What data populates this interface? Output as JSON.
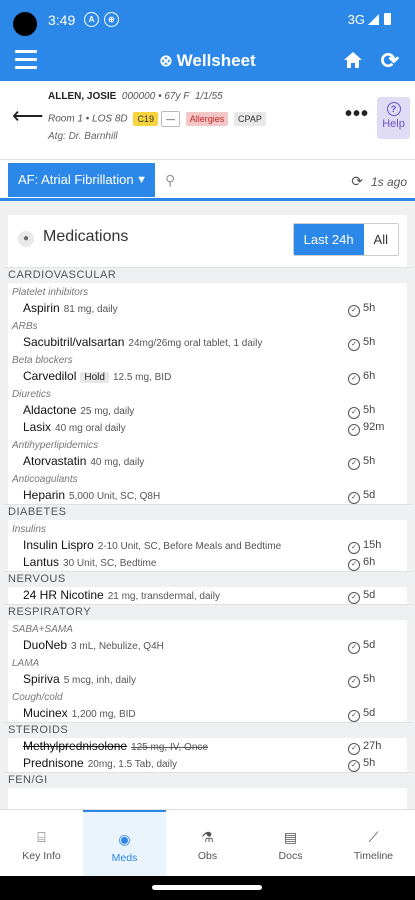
{
  "status": {
    "time": "3:49",
    "icon1": "A",
    "network": "3G"
  },
  "header": {
    "app_name": "Wellsheet"
  },
  "patient": {
    "name": "ALLEN, JOSIE",
    "mrn": "000000",
    "age_sex": "67y F",
    "dob": "1/1/55",
    "room": "Room 1",
    "los": "LOS 8D",
    "tags": {
      "c19": "C19",
      "dash": "—",
      "allergies": "Allergies",
      "cpap": "CPAP"
    },
    "attending": "Atg: Dr. Barnhill"
  },
  "help_label": "Help",
  "problem": {
    "label": "AF: Atrial Fibrillation",
    "updated": "1s ago"
  },
  "meds_panel": {
    "title": "Medications",
    "filters": [
      "Last 24h",
      "All"
    ],
    "active_filter": "Last 24h"
  },
  "categories": [
    {
      "name": "CARDIOVASCULAR",
      "groups": [
        {
          "name": "Platelet inhibitors",
          "meds": [
            {
              "name": "Aspirin",
              "detail": "81 mg, daily",
              "time": "5h"
            }
          ]
        },
        {
          "name": "ARBs",
          "meds": [
            {
              "name": "Sacubitril/valsartan",
              "detail": "24mg/26mg oral tablet, 1 daily",
              "time": "5h"
            }
          ]
        },
        {
          "name": "Beta blockers",
          "meds": [
            {
              "name": "Carvedilol",
              "hold": "Hold",
              "detail": "12.5 mg, BID",
              "time": "6h"
            }
          ]
        },
        {
          "name": "Diuretics",
          "meds": [
            {
              "name": "Aldactone",
              "detail": "25 mg, daily",
              "time": "5h"
            },
            {
              "name": "Lasix",
              "detail": "40 mg oral daily",
              "time": "92m"
            }
          ]
        },
        {
          "name": "Antihyperlipidemics",
          "meds": [
            {
              "name": "Atorvastatin",
              "detail": "40 mg, daily",
              "time": "5h"
            }
          ]
        },
        {
          "name": "Anticoagulants",
          "meds": [
            {
              "name": "Heparin",
              "detail": "5,000 Unit, SC, Q8H",
              "time": "5d"
            }
          ]
        }
      ]
    },
    {
      "name": "DIABETES",
      "groups": [
        {
          "name": "Insulins",
          "meds": [
            {
              "name": "Insulin Lispro",
              "detail": "2-10 Unit, SC, Before Meals and Bedtime",
              "time": "15h"
            },
            {
              "name": "Lantus",
              "detail": "30 Unit, SC, Bedtime",
              "time": "6h"
            }
          ]
        }
      ]
    },
    {
      "name": "NERVOUS",
      "groups": [
        {
          "name": "",
          "meds": [
            {
              "name": "24 HR Nicotine",
              "detail": "21 mg, transdermal, daily",
              "time": "5d"
            }
          ]
        }
      ]
    },
    {
      "name": "RESPIRATORY",
      "groups": [
        {
          "name": "SABA+SAMA",
          "meds": [
            {
              "name": "DuoNeb",
              "detail": "3 mL, Nebulize, Q4H",
              "time": "5d"
            }
          ]
        },
        {
          "name": "LAMA",
          "meds": [
            {
              "name": "Spiriva",
              "detail": "5 mcg, inh, daily",
              "time": "5h"
            }
          ]
        },
        {
          "name": "Cough/cold",
          "meds": [
            {
              "name": "Mucinex",
              "detail": "1,200 mg, BID",
              "time": "5d"
            }
          ]
        }
      ]
    },
    {
      "name": "STEROIDS",
      "groups": [
        {
          "name": "",
          "meds": [
            {
              "name": "Methylprednisolone",
              "detail": "125 mg, IV, Once",
              "time": "27h",
              "discontinued": true
            },
            {
              "name": "Prednisone",
              "detail": "20mg, 1.5 Tab, daily",
              "time": "5h"
            }
          ]
        }
      ]
    },
    {
      "name": "FEN/GI",
      "groups": []
    }
  ],
  "nav": [
    {
      "label": "Key Info",
      "icon": "key-info-icon"
    },
    {
      "label": "Meds",
      "icon": "pill-icon"
    },
    {
      "label": "Obs",
      "icon": "flask-icon"
    },
    {
      "label": "Docs",
      "icon": "document-icon"
    },
    {
      "label": "Timeline",
      "icon": "timeline-icon"
    }
  ],
  "nav_active": "Meds"
}
